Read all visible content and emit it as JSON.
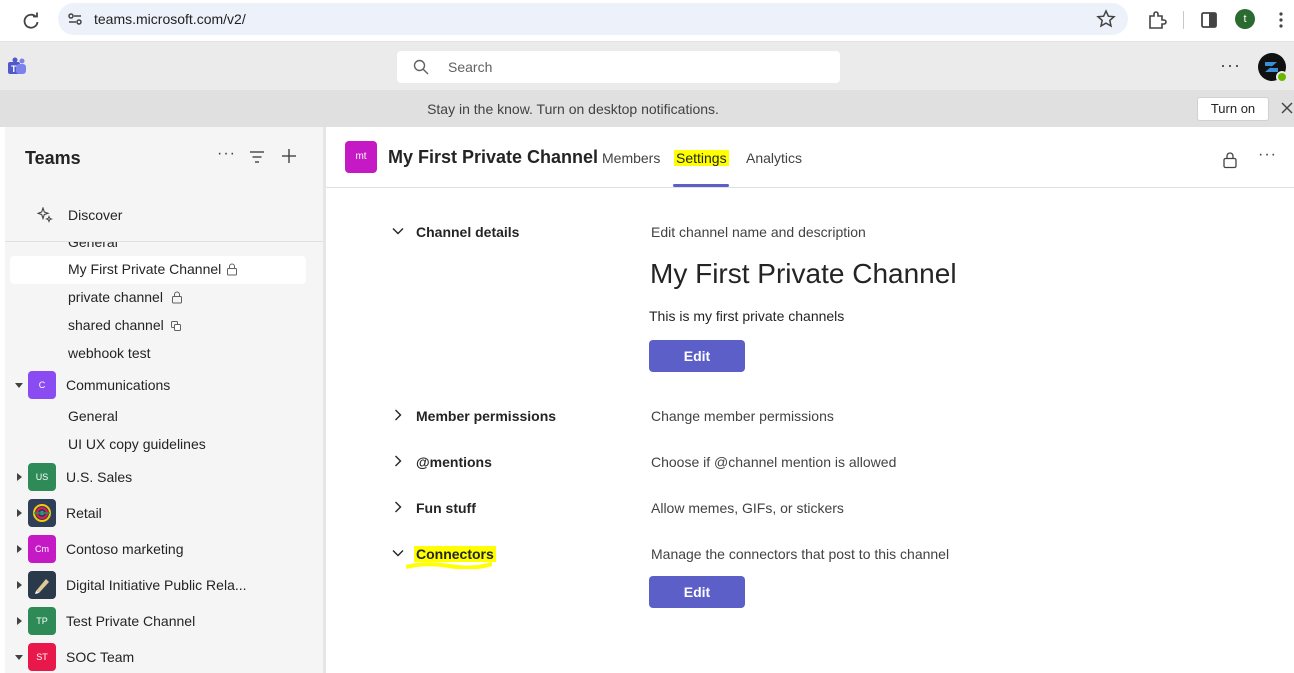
{
  "browser": {
    "url": "teams.microsoft.com/v2/",
    "profile_initial": "t"
  },
  "header": {
    "search_placeholder": "Search",
    "more": "···"
  },
  "notification": {
    "text": "Stay in the know. Turn on desktop notifications.",
    "button": "Turn on"
  },
  "sidebar": {
    "title": "Teams",
    "more": "···",
    "discover": "Discover",
    "items": [
      {
        "kind": "channel",
        "label": "General"
      },
      {
        "kind": "channel",
        "label": "My First Private Channel",
        "icon": "lock-icon",
        "selected": true
      },
      {
        "kind": "channel",
        "label": "private channel",
        "icon": "lock-icon"
      },
      {
        "kind": "channel",
        "label": "shared channel",
        "icon": "shared-icon"
      },
      {
        "kind": "channel",
        "label": "webhook test"
      },
      {
        "kind": "team",
        "label": "Communications",
        "initials": "C",
        "color": "#8a4cf2",
        "expanded": true
      },
      {
        "kind": "channel",
        "label": "General"
      },
      {
        "kind": "channel",
        "label": "UI UX copy guidelines"
      },
      {
        "kind": "team",
        "label": "U.S. Sales",
        "initials": "US",
        "color": "#2e8b57",
        "expanded": false
      },
      {
        "kind": "team",
        "label": "Retail",
        "initials": "",
        "color": "#2f3f57",
        "icon": "globe-logo-icon",
        "expanded": false
      },
      {
        "kind": "team",
        "label": "Contoso marketing",
        "initials": "Cm",
        "color": "#c619c6",
        "expanded": false
      },
      {
        "kind": "team",
        "label": "Digital Initiative Public Rela...",
        "initials": "",
        "color": "#2b3a4a",
        "icon": "pen-logo-icon",
        "expanded": false
      },
      {
        "kind": "team",
        "label": "Test Private Channel",
        "initials": "TP",
        "color": "#2e8b57",
        "expanded": false
      },
      {
        "kind": "team",
        "label": "SOC Team",
        "initials": "ST",
        "color": "#e8194a",
        "expanded": true
      }
    ]
  },
  "channel": {
    "initials": "mt",
    "name": "My First Private Channel",
    "tabs": [
      {
        "label": "Members",
        "active": false
      },
      {
        "label": "Settings",
        "active": true
      },
      {
        "label": "Analytics",
        "active": false
      }
    ],
    "more": "···"
  },
  "settings": {
    "details_title": "Channel details",
    "details_desc": "Edit channel name and description",
    "channel_name": "My First Private Channel",
    "channel_description": "This is my first private channels",
    "edit_label": "Edit",
    "sections": [
      {
        "title": "Member permissions",
        "desc": "Change member permissions",
        "expanded": false
      },
      {
        "title": "@mentions",
        "desc": "Choose if @channel mention is allowed",
        "expanded": false
      },
      {
        "title": "Fun stuff",
        "desc": "Allow memes, GIFs, or stickers",
        "expanded": false
      },
      {
        "title": "Connectors",
        "desc": "Manage the connectors that post to this channel",
        "expanded": true
      }
    ],
    "connectors_edit_label": "Edit"
  },
  "colors": {
    "accent": "#5b5fc7",
    "highlight": "#ffff00",
    "sidebar_bg": "#f5f5f5",
    "header_bg": "#ebebeb"
  }
}
